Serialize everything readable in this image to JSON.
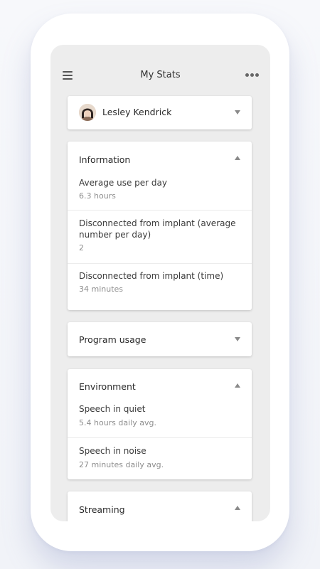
{
  "header": {
    "title": "My Stats",
    "menu_icon": "hamburger-menu-icon",
    "more_icon": "more-options-icon"
  },
  "profile": {
    "name": "Lesley Kendrick",
    "avatar_icon": "user-avatar"
  },
  "sections": {
    "information": {
      "title": "Information",
      "expanded": true,
      "items": [
        {
          "label": "Average use per day",
          "value": "6.3 hours"
        },
        {
          "label": "Disconnected from implant (average number per day)",
          "value": "2"
        },
        {
          "label": "Disconnected from implant (time)",
          "value": "34 minutes"
        }
      ]
    },
    "program_usage": {
      "title": "Program usage",
      "expanded": false
    },
    "environment": {
      "title": "Environment",
      "expanded": true,
      "items": [
        {
          "label": "Speech in quiet",
          "value": "5.4 hours daily avg."
        },
        {
          "label": "Speech in noise",
          "value": "27 minutes daily avg."
        }
      ]
    },
    "streaming": {
      "title": "Streaming",
      "expanded": true
    }
  },
  "colors": {
    "background": "#f4f5f9",
    "phone": "#ffffff",
    "screen": "#ededed",
    "card": "#ffffff",
    "text_primary": "#2b2b2b",
    "text_secondary": "#8e8e8e"
  }
}
